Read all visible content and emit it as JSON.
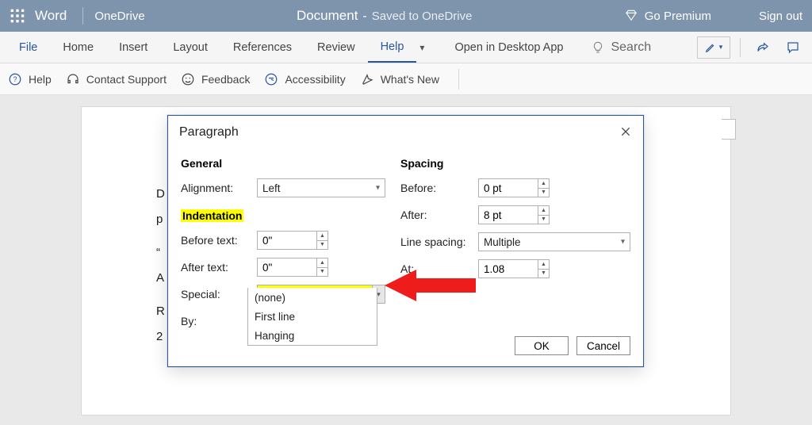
{
  "titlebar": {
    "app": "Word",
    "location": "OneDrive",
    "doc_name": "Document",
    "saved_status": "Saved to OneDrive",
    "premium": "Go Premium",
    "signout": "Sign out"
  },
  "tabs": {
    "file": "File",
    "items": [
      "Home",
      "Insert",
      "Layout",
      "References",
      "Review",
      "Help"
    ],
    "active_index": 5,
    "open_desktop": "Open in Desktop App",
    "search": "Search"
  },
  "helpbar": {
    "help": "Help",
    "support": "Contact Support",
    "feedback": "Feedback",
    "accessibility": "Accessibility",
    "whatsnew": "What's New"
  },
  "page": {
    "lines": [
      "D",
      "p",
      "“",
      "A",
      "R",
      "2"
    ]
  },
  "dialog": {
    "title": "Paragraph",
    "general": {
      "heading": "General",
      "alignment_label": "Alignment:",
      "alignment_value": "Left"
    },
    "indentation": {
      "heading": "Indentation",
      "before_label": "Before text:",
      "before_value": "0\"",
      "after_label": "After text:",
      "after_value": "0\"",
      "special_label": "Special:",
      "special_value": "Hanging",
      "special_options": [
        "(none)",
        "First line",
        "Hanging"
      ],
      "by_label": "By:"
    },
    "spacing": {
      "heading": "Spacing",
      "before_label": "Before:",
      "before_value": "0 pt",
      "after_label": "After:",
      "after_value": "8 pt",
      "linespacing_label": "Line spacing:",
      "linespacing_value": "Multiple",
      "at_label": "At:",
      "at_value": "1.08"
    },
    "ok": "OK",
    "cancel": "Cancel"
  }
}
